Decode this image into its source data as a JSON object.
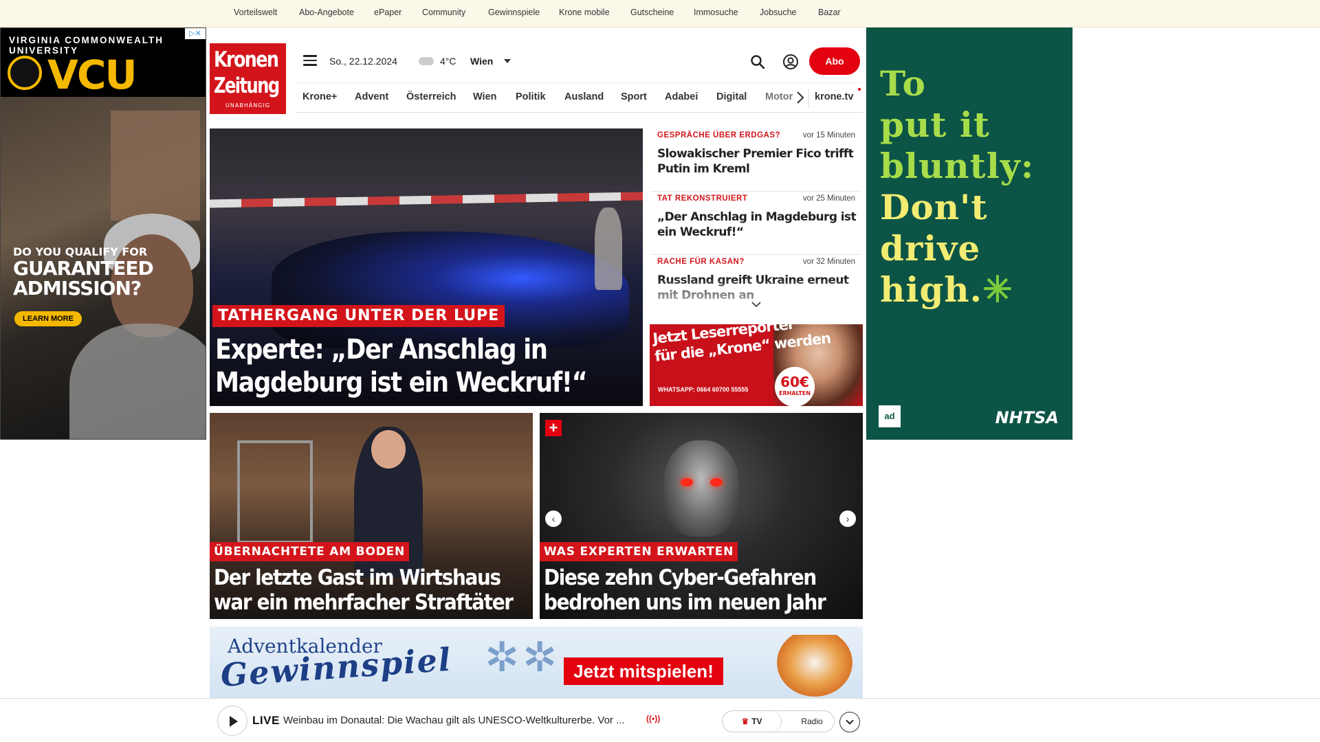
{
  "topnav": [
    "Vorteilswelt",
    "Abo-Angebote",
    "ePaper",
    "Community",
    "Gewinnspiele",
    "Krone mobile",
    "Gutscheine",
    "Immosuche",
    "Jobsuche",
    "Bazar"
  ],
  "ad_left": {
    "university": "VIRGINIA COMMONWEALTH UNIVERSITY",
    "logo": "VCU",
    "question_line1": "DO YOU QUALIFY FOR",
    "question_line2": "GUARANTEED",
    "question_line3": "ADMISSION?",
    "cta": "LEARN MORE",
    "ad_marker": "▷✕"
  },
  "ad_right": {
    "line1": "To",
    "line2": "put it",
    "line3": "bluntly:",
    "line4": "Don't",
    "line5": "drive",
    "line6": "high.",
    "left_logo": "ad",
    "right_logo": "NHTSA"
  },
  "header": {
    "brand_line1": "Kronen",
    "brand_line2": "Zeitung",
    "brand_line3": "UNABHÄNGIG",
    "date": "So., 22.12.2024",
    "temperature": "4°C",
    "city": "Wien",
    "abo_label": "Abo"
  },
  "nav": [
    "Krone+",
    "Advent",
    "Österreich",
    "Wien",
    "Politik",
    "Ausland",
    "Sport",
    "Adabei",
    "Digital",
    "Motor",
    "krone.tv"
  ],
  "hero": {
    "kicker": "TATHERGANG UNTER DER LUPE",
    "headline_line1": "Experte: „Der Anschlag in",
    "headline_line2": "Magdeburg ist ein Weckruf!“"
  },
  "ticker": [
    {
      "kicker": "GESPRÄCHE ÜBER ERDGAS?",
      "time": "vor 15 Minuten",
      "headline": "Slowakischer Premier Fico trifft Putin im Kreml"
    },
    {
      "kicker": "TAT REKONSTRUIERT",
      "time": "vor 25 Minuten",
      "headline": "„Der Anschlag in Magdeburg ist ein Weckruf!“"
    },
    {
      "kicker": "RACHE FÜR KASAN?",
      "time": "vor 32 Minuten",
      "headline": "Russland greift Ukraine erneut mit Drohnen an"
    }
  ],
  "promo": {
    "line1": "Jetzt Leserreporter",
    "line2": "für die „Krone“ werden",
    "whatsapp": "WHATSAPP: 0664 60700 55555",
    "amount": "60€",
    "amount_label": "ERHALTEN"
  },
  "teasers": [
    {
      "kicker": "ÜBERNACHTETE AM BODEN",
      "headline_line1": "Der letzte Gast im Wirtshaus",
      "headline_line2": "war ein mehrfacher Straftäter"
    },
    {
      "kicker": "WAS EXPERTEN ERWARTEN",
      "headline_line1": "Diese zehn Cyber-Gefahren",
      "headline_line2": "bedrohen uns im neuen Jahr"
    }
  ],
  "advent": {
    "line1": "Adventkalender",
    "line2": "Gewinnspiel",
    "cta": "Jetzt mitspielen!"
  },
  "livebar": {
    "live_label": "LIVE",
    "title": "Weinbau im Donautal: Die Wachau gilt als UNESCO-Weltkulturerbe. Vor ...",
    "tv_label": "TV",
    "radio_label": "Radio"
  }
}
